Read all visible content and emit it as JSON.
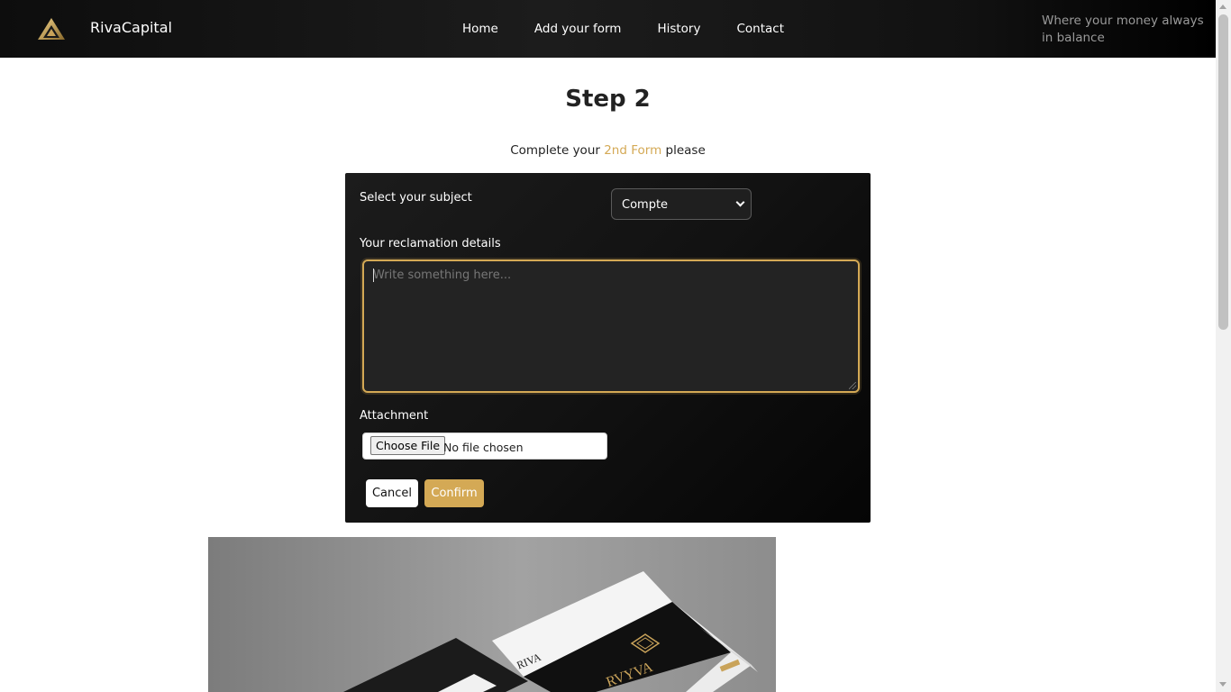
{
  "brand": {
    "name": "RivaCapital"
  },
  "nav": {
    "items": [
      {
        "label": "Home"
      },
      {
        "label": "Add your form"
      },
      {
        "label": "History"
      },
      {
        "label": "Contact"
      }
    ]
  },
  "tagline": "Where your money always in balance",
  "page": {
    "title": "Step 2",
    "subtitle_before": "Complete your ",
    "subtitle_accent": "2nd Form",
    "subtitle_after": " please"
  },
  "form": {
    "subject_label": "Select your subject",
    "subject_value": "Compte",
    "details_label": "Your reclamation details",
    "details_placeholder": "Write something here...",
    "attachment_label": "Attachment",
    "file_button": "Choose File",
    "file_status": "No file chosen",
    "cancel_label": "Cancel",
    "confirm_label": "Confirm"
  },
  "product_image": {
    "card_text_left": "RIVA",
    "card_text_center": "RVYVA"
  },
  "colors": {
    "accent": "#d4a955",
    "navbar": "#111111",
    "card": "#141414"
  }
}
